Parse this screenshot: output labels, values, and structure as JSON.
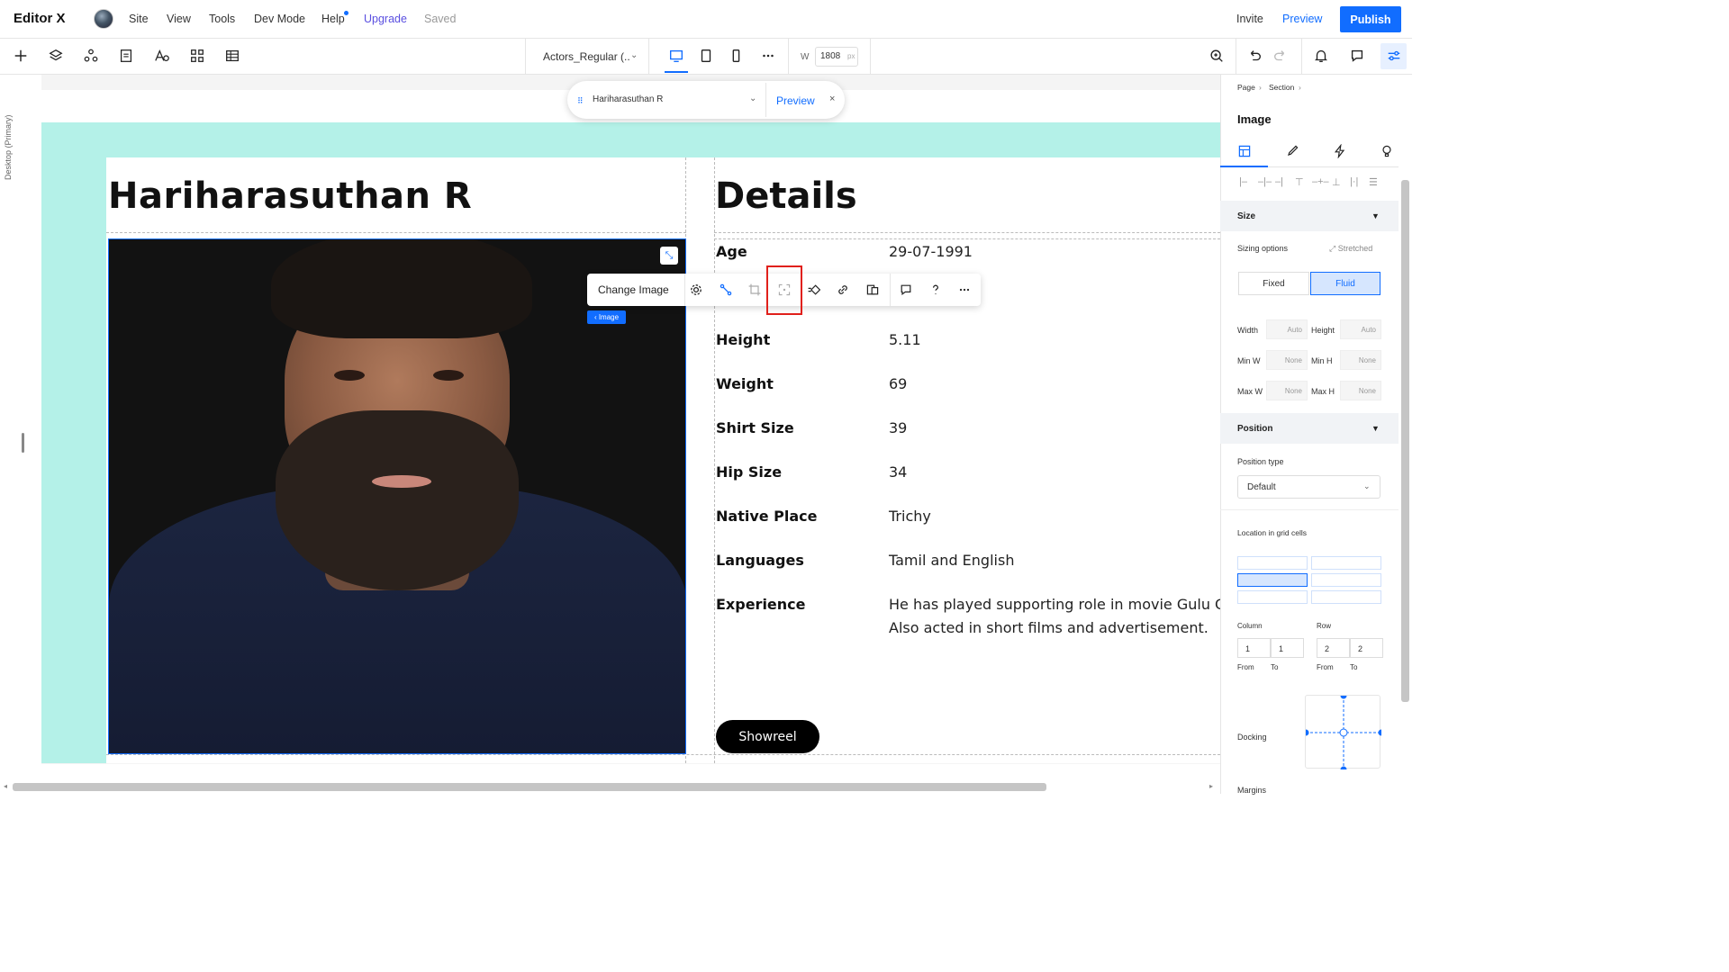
{
  "app": {
    "logo": "Editor X",
    "menu": [
      "Site",
      "View",
      "Tools",
      "Dev Mode",
      "Help"
    ],
    "upgrade": "Upgrade",
    "saved": "Saved",
    "invite": "Invite",
    "preview": "Preview",
    "publish": "Publish",
    "accent": "#116dff"
  },
  "toolbar": {
    "page_select": "Actors_Regular (..",
    "width_label": "W",
    "width_value": "1808",
    "width_unit": "px"
  },
  "left_rail": {
    "breakpoint_label": "Desktop (Primary)"
  },
  "floating_pill": {
    "name": "Hariharasuthan R",
    "preview": "Preview",
    "close": "×"
  },
  "page": {
    "name": "Hariharasuthan R",
    "details_title": "Details",
    "details": [
      {
        "label": "Age",
        "value": "29-07-1991"
      },
      {
        "label": "Height",
        "value": "5.11"
      },
      {
        "label": "Weight",
        "value": "69"
      },
      {
        "label": "Shirt Size",
        "value": "39"
      },
      {
        "label": "Hip Size",
        "value": "34"
      },
      {
        "label": "Native Place",
        "value": "Trichy"
      },
      {
        "label": "Languages",
        "value": "Tamil and English"
      },
      {
        "label": "Experience",
        "value": "He has played supporting role in movie Gulu Gul",
        "value2": "Also acted in short films and advertisement."
      }
    ],
    "showreel": "Showreel"
  },
  "image_toolbar": {
    "change_image": "Change Image",
    "tag": "‹ Image"
  },
  "panel": {
    "breadcrumb": [
      "Page",
      "Section"
    ],
    "title": "Image",
    "size_section": "Size",
    "sizing_options": "Sizing options",
    "stretched": "Stretched",
    "fixed": "Fixed",
    "fluid": "Fluid",
    "width_label": "Width",
    "height_label": "Height",
    "min_w": "Min W",
    "min_h": "Min H",
    "max_w": "Max W",
    "max_h": "Max H",
    "auto": "Auto",
    "none": "None",
    "position_section": "Position",
    "position_type": "Position type",
    "position_value": "Default",
    "location": "Location in grid cells",
    "column": "Column",
    "row": "Row",
    "col_from": "1",
    "col_to": "1",
    "row_from": "2",
    "row_to": "2",
    "from": "From",
    "to": "To",
    "docking": "Docking",
    "margins": "Margins"
  }
}
